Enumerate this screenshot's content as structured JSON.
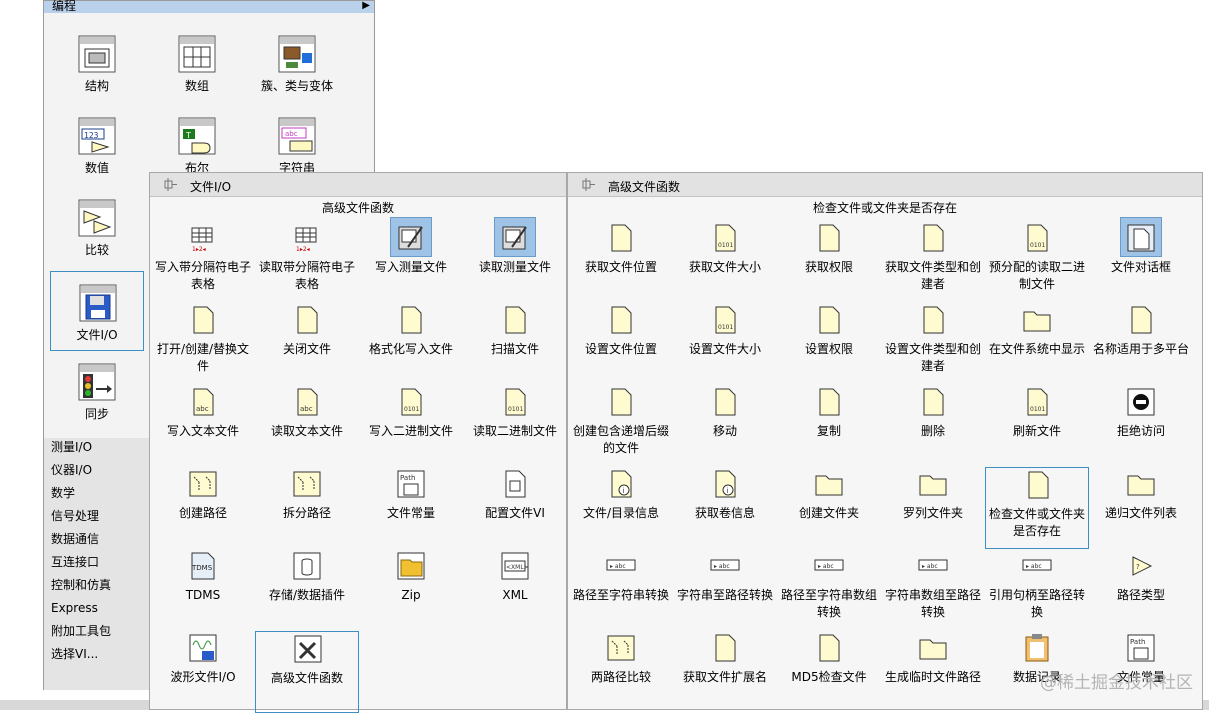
{
  "back_palette": {
    "header": "编程",
    "items": [
      {
        "label": "结构",
        "icon": "structure-icon"
      },
      {
        "label": "数组",
        "icon": "array-icon"
      },
      {
        "label": "簇、类与变体",
        "icon": "cluster-icon"
      },
      {
        "label": "数值",
        "icon": "numeric-icon"
      },
      {
        "label": "布尔",
        "icon": "boolean-icon"
      },
      {
        "label": "字符串",
        "icon": "string-icon"
      },
      {
        "label": "比较",
        "icon": "comparison-icon"
      },
      {
        "label": "文件I/O",
        "icon": "floppy-disk-icon"
      },
      {
        "label": "同步",
        "icon": "traffic-light-icon"
      }
    ],
    "categories": [
      "测量I/O",
      "仪器I/O",
      "数学",
      "信号处理",
      "数据通信",
      "互连接口",
      "控制和仿真",
      "Express",
      "附加工具包",
      "选择VI..."
    ]
  },
  "file_io_panel": {
    "title": "文件I/O",
    "subtitle": "高级文件函数",
    "items": [
      "写入带分隔符电子表格",
      "读取带分隔符电子表格",
      "写入测量文件",
      "读取测量文件",
      "打开/创建/替换文件",
      "关闭文件",
      "格式化写入文件",
      "扫描文件",
      "写入文本文件",
      "读取文本文件",
      "写入二进制文件",
      "读取二进制文件",
      "创建路径",
      "拆分路径",
      "文件常量",
      "配置文件VI",
      "TDMS",
      "存储/数据插件",
      "Zip",
      "XML",
      "波形文件I/O",
      "高级文件函数"
    ]
  },
  "adv_panel": {
    "title": "高级文件函数",
    "subtitle": "检查文件或文件夹是否存在",
    "items": [
      "获取文件位置",
      "获取文件大小",
      "获取权限",
      "获取文件类型和创建者",
      "预分配的读取二进制文件",
      "文件对话框",
      "设置文件位置",
      "设置文件大小",
      "设置权限",
      "设置文件类型和创建者",
      "在文件系统中显示",
      "名称适用于多平台",
      "创建包含递增后缀的文件",
      "移动",
      "复制",
      "删除",
      "刷新文件",
      "拒绝访问",
      "文件/目录信息",
      "获取卷信息",
      "创建文件夹",
      "罗列文件夹",
      "检查文件或文件夹是否存在",
      "递归文件列表",
      "路径至字符串转换",
      "字符串至路径转换",
      "路径至字符串数组转换",
      "字符串数组至路径转换",
      "引用句柄至路径转换",
      "路径类型",
      "两路径比较",
      "获取文件扩展名",
      "MD5检查文件",
      "生成临时文件路径",
      "数据记录",
      "文件常量"
    ]
  },
  "watermark": "@稀土掘金技术社区"
}
